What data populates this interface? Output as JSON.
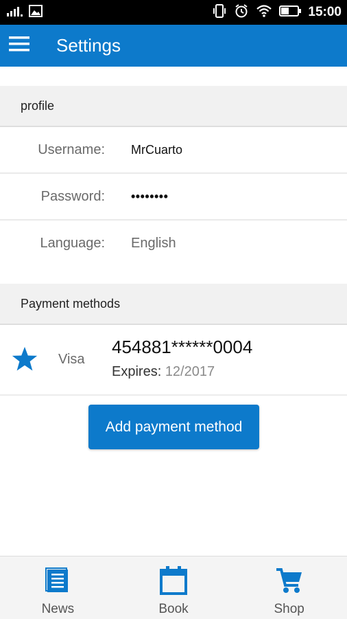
{
  "statusbar": {
    "time": "15:00"
  },
  "appbar": {
    "title": "Settings"
  },
  "profile": {
    "header": "profile",
    "fields": [
      {
        "label": "Username:",
        "value": "MrCuarto"
      },
      {
        "label": "Password:",
        "value": "••••••••"
      },
      {
        "label": "Language:",
        "value": "English"
      }
    ]
  },
  "payment": {
    "header": "Payment methods",
    "card": {
      "type": "Visa",
      "number": "454881******0004",
      "expires_label": "Expires:",
      "expires_value": "12/2017"
    },
    "add_button": "Add payment method"
  },
  "bottom_nav": [
    {
      "label": "News",
      "icon": "news-icon"
    },
    {
      "label": "Book",
      "icon": "calendar-icon"
    },
    {
      "label": "Shop",
      "icon": "cart-icon"
    }
  ],
  "colors": {
    "accent": "#0d7acb"
  }
}
